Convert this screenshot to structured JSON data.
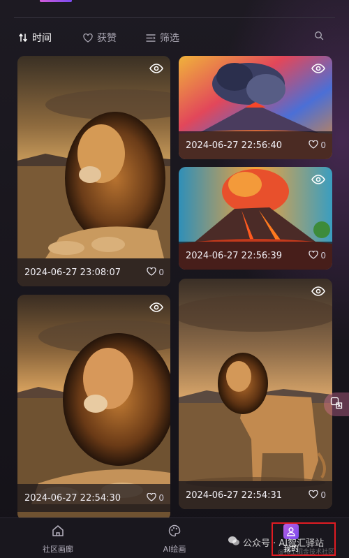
{
  "filters": {
    "time": "时间",
    "likes": "获赞",
    "filter": "筛选"
  },
  "cards": [
    {
      "timestamp": "2024-06-27 23:08:07",
      "likes": "0",
      "subject": "lion-lying"
    },
    {
      "timestamp": "2024-06-27 22:56:40",
      "likes": "0",
      "subject": "volcano"
    },
    {
      "timestamp": "2024-06-27 22:56:39",
      "likes": "0",
      "subject": "volcano"
    },
    {
      "timestamp": "2024-06-27 22:54:30",
      "likes": "0",
      "subject": "lion-lying"
    },
    {
      "timestamp": "2024-06-27 22:54:31",
      "likes": "0",
      "subject": "lion-standing"
    }
  ],
  "nav": {
    "community": "社区画廊",
    "ai_draw": "AI绘画",
    "mine": "我的"
  },
  "watermark": {
    "text": "公众号 · AI智汇驿站",
    "sub": "@稀土掘金技术社区"
  },
  "colors": {
    "accent": "#7a4bf0",
    "highlight": "#e11b22"
  }
}
